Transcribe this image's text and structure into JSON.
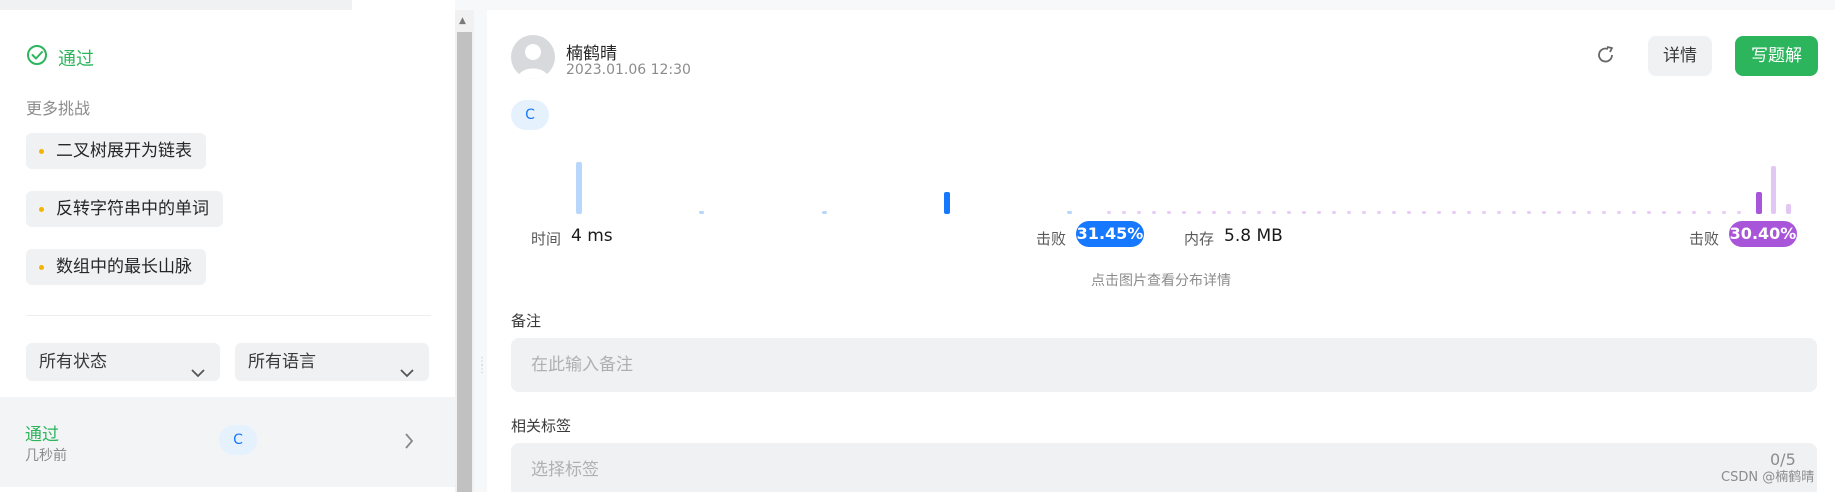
{
  "left": {
    "status": "通过",
    "more_challenges_label": "更多挑战",
    "challenges": [
      "二叉树展开为链表",
      "反转字符串中的单词",
      "数组中的最长山脉"
    ],
    "filters": {
      "status": "所有状态",
      "language": "所有语言"
    },
    "submission": {
      "status": "通过",
      "time": "几秒前",
      "language": "C"
    }
  },
  "right": {
    "author": "楠鹤晴",
    "date": "2023.01.06 12:30",
    "buttons": {
      "detail": "详情",
      "write_solution": "写题解"
    },
    "language": "C",
    "runtime": {
      "label": "时间",
      "value": "4 ms",
      "beat_label": "击败",
      "beat_value": "31.45%"
    },
    "memory": {
      "label": "内存",
      "value": "5.8 MB",
      "beat_label": "击败",
      "beat_value": "30.40%"
    },
    "hint": "点击图片查看分布详情",
    "notes": {
      "label": "备注",
      "placeholder": "在此输入备注"
    },
    "tags": {
      "label": "相关标签",
      "placeholder": "选择标签",
      "counter": "0/5"
    }
  },
  "watermark": "CSDN @楠鹤晴",
  "colors": {
    "accept": "#2db55d",
    "runtime": "#1677ff",
    "memory": "#a855d9",
    "pending_dot": "#f5b301"
  },
  "icons": [
    "check-circle-icon",
    "chevron-down-icon",
    "chevron-right-icon",
    "refresh-icon",
    "avatar-icon"
  ]
}
